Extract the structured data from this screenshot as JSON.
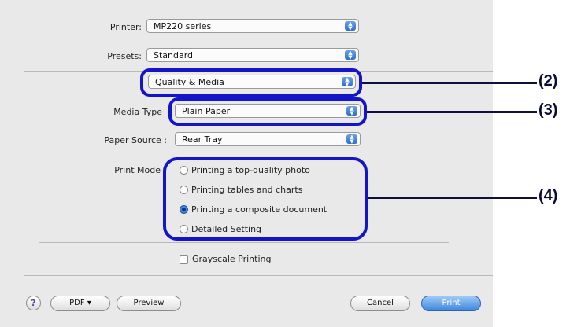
{
  "printer": {
    "label": "Printer:",
    "value": "MP220 series"
  },
  "presets": {
    "label": "Presets:",
    "value": "Standard"
  },
  "panel": {
    "value": "Quality & Media"
  },
  "media_type": {
    "label": "Media Type",
    "value": "Plain Paper"
  },
  "paper_source": {
    "label": "Paper Source :",
    "value": "Rear Tray"
  },
  "print_mode": {
    "label": "Print Mode",
    "options": [
      {
        "label": "Printing a top-quality photo",
        "selected": false
      },
      {
        "label": "Printing tables and charts",
        "selected": false
      },
      {
        "label": "Printing a composite document",
        "selected": true
      },
      {
        "label": "Detailed Setting",
        "selected": false
      }
    ]
  },
  "grayscale": {
    "label": "Grayscale Printing",
    "checked": false
  },
  "buttons": {
    "help": "?",
    "pdf": "PDF ▾",
    "preview": "Preview",
    "cancel": "Cancel",
    "print": "Print"
  },
  "callouts": [
    "(2)",
    "(3)",
    "(4)"
  ],
  "colors": {
    "highlight": "#1515c8",
    "default_button": "#3e86de"
  }
}
